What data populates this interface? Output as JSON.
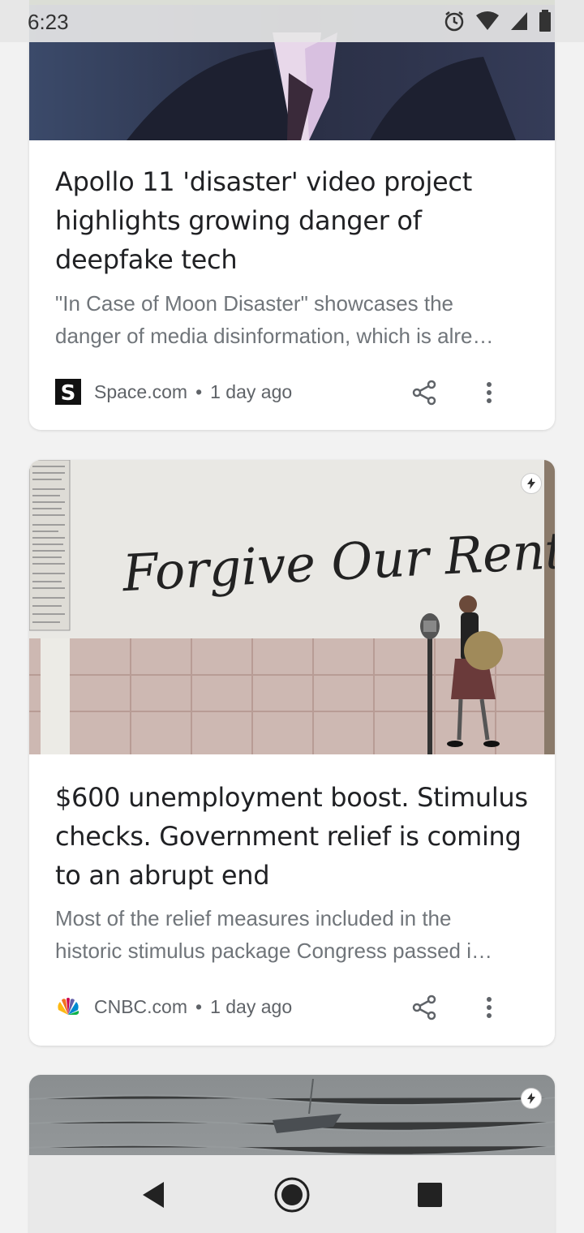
{
  "status_bar": {
    "time": "6:23",
    "icons": [
      "alarm-icon",
      "wifi-icon",
      "signal-icon",
      "battery-icon"
    ]
  },
  "cards": [
    {
      "headline": "Apollo 11 'disaster' video project highlights growing danger of deepfake tech",
      "snippet_line1": "\"In Case of Moon Disaster\" showcases the",
      "snippet_line2": "danger of media disinformation, which is alre…",
      "source": "Space.com",
      "time": "1 day ago",
      "logo_text": "S",
      "image_desc_icon": "image-thumbnail-icon"
    },
    {
      "headline": "$600 unemployment boost. Stimulus checks. Government relief is coming to an abrupt end",
      "snippet_line1": "Most of the relief measures included in the",
      "snippet_line2": "historic stimulus package Congress passed i…",
      "source": "CNBC.com",
      "time": "1 day ago",
      "image_text": "Forgive Our Rent",
      "amp": true
    },
    {
      "amp": true
    }
  ],
  "separator": "•",
  "nav": {
    "icons": [
      "back-icon",
      "home-icon",
      "recents-icon"
    ]
  },
  "colors": {
    "text_primary": "#202124",
    "text_secondary": "#70757a",
    "cnbc_peacock": [
      "#fdb913",
      "#f37021",
      "#cc004c",
      "#6460aa",
      "#0089d0",
      "#0db14b"
    ]
  }
}
